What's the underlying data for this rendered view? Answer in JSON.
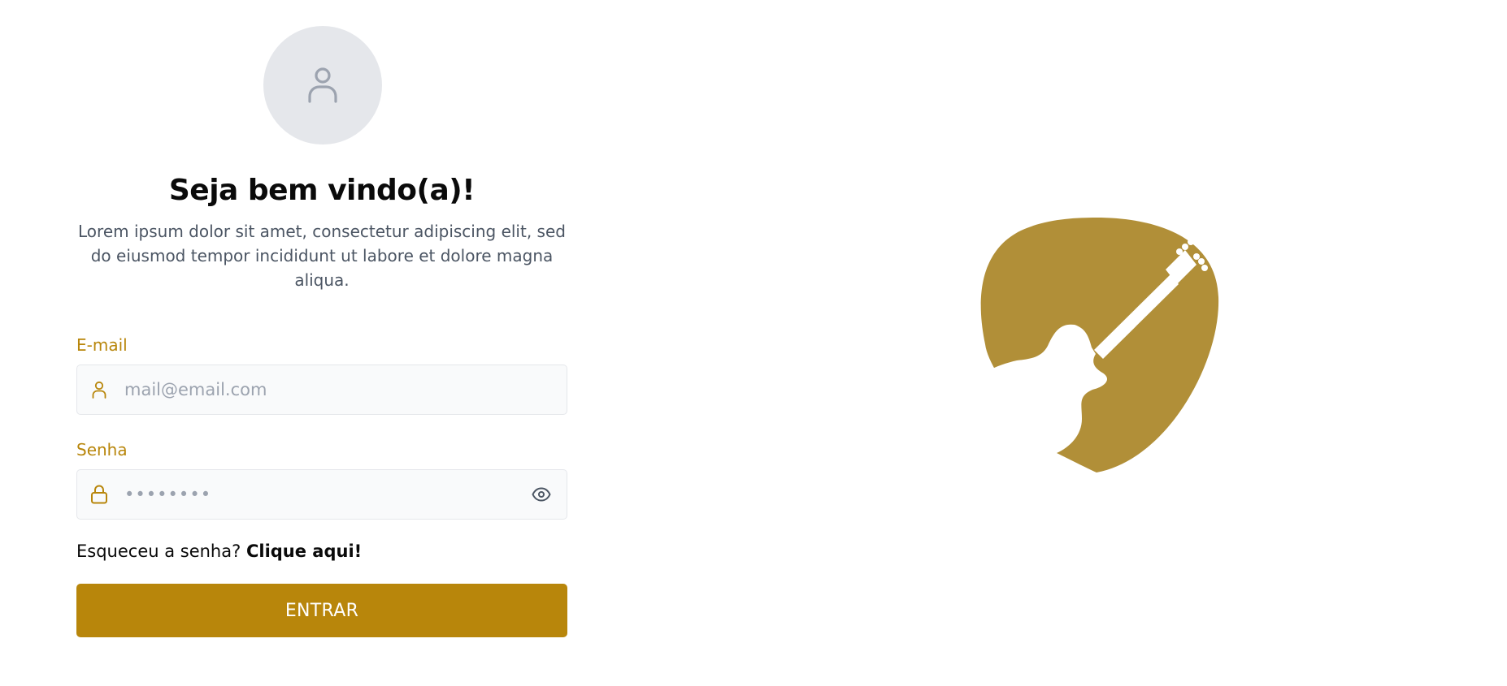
{
  "header": {
    "title": "Seja bem vindo(a)!",
    "subtitle": "Lorem ipsum dolor sit amet, consectetur adipiscing elit, sed do eiusmod tempor incididunt ut labore et dolore magna aliqua."
  },
  "form": {
    "email_label": "E-mail",
    "email_placeholder": "mail@email.com",
    "email_value": "",
    "password_label": "Senha",
    "password_value": "••••••••",
    "forgot_text": "Esqueceu a senha?",
    "forgot_link": "Clique aqui!",
    "submit_label": "ENTRAR"
  },
  "icons": {
    "avatar": "user-icon",
    "email_field": "user-icon",
    "password_field": "lock-icon",
    "password_toggle": "eye-icon",
    "brand": "guitar-pick-logo"
  },
  "colors": {
    "accent": "#b8860b",
    "logo": "#b18f38",
    "avatar_bg": "#e5e7eb",
    "field_bg": "#f9fafb"
  }
}
